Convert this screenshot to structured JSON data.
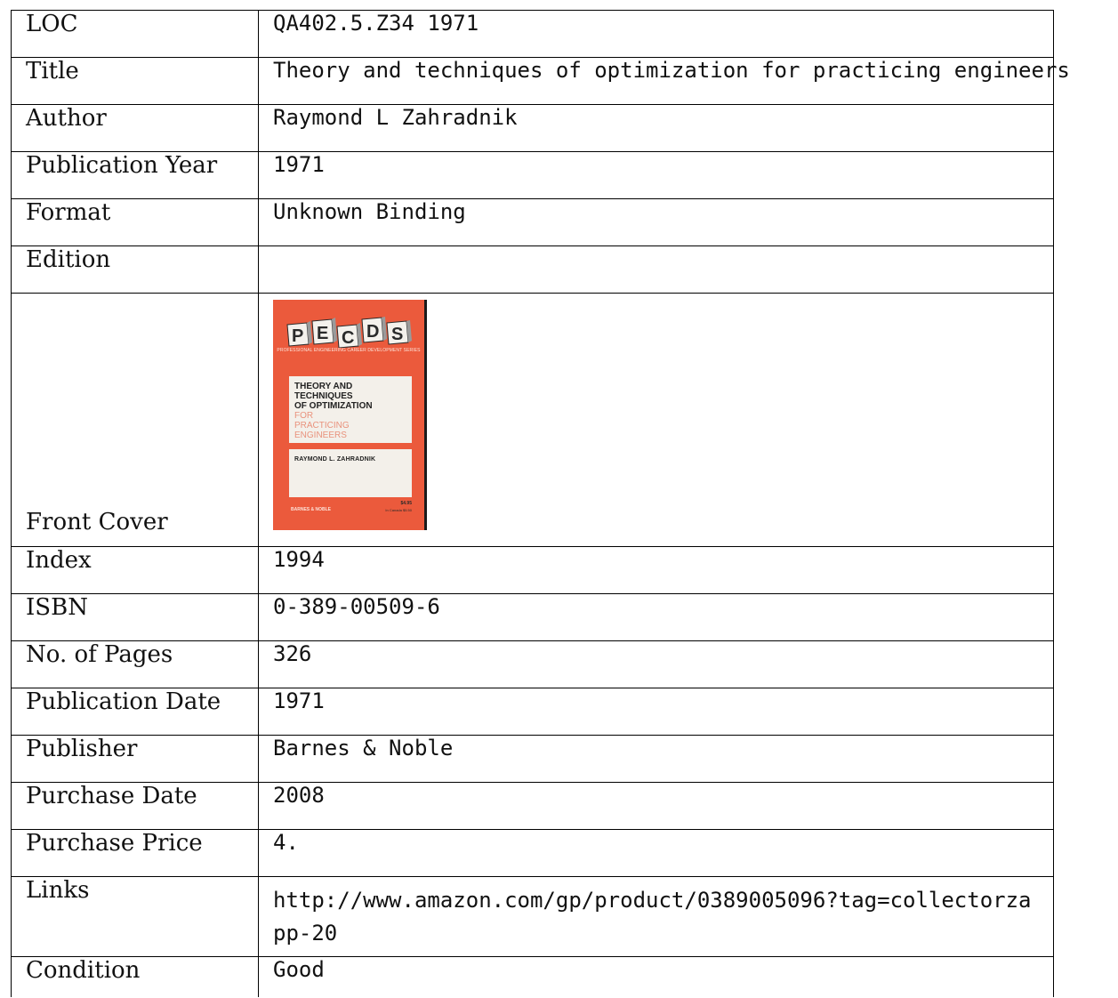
{
  "record": {
    "loc": {
      "label": "LOC",
      "value": "QA402.5.Z34 1971"
    },
    "title": {
      "label": "Title",
      "value": "Theory and techniques of optimization for practicing engineers"
    },
    "author": {
      "label": "Author",
      "value": "Raymond L Zahradnik"
    },
    "publication_year": {
      "label": "Publication Year",
      "value": "1971"
    },
    "format": {
      "label": "Format",
      "value": "Unknown Binding"
    },
    "edition": {
      "label": "Edition",
      "value": ""
    },
    "front_cover": {
      "label": "Front Cover"
    },
    "index": {
      "label": "Index",
      "value": "1994"
    },
    "isbn": {
      "label": "ISBN",
      "value": "0-389-00509-6"
    },
    "pages": {
      "label": "No. of Pages",
      "value": "326"
    },
    "publication_date": {
      "label": "Publication Date",
      "value": "1971"
    },
    "publisher": {
      "label": "Publisher",
      "value": "Barnes & Noble"
    },
    "purchase_date": {
      "label": "Purchase Date",
      "value": "2008"
    },
    "purchase_price": {
      "label": "Purchase Price",
      "value": "4."
    },
    "links": {
      "label": "Links",
      "value": "http://www.amazon.com/gp/product/0389005096?tag=collectorzapp-20"
    },
    "condition": {
      "label": "Condition",
      "value": "Good"
    }
  },
  "cover": {
    "logo_text": "PECDS",
    "series": "PROFESSIONAL ENGINEERING CAREER DEVELOPMENT SERIES",
    "title_dark": [
      "THEORY AND",
      "TECHNIQUES",
      "OF OPTIMIZATION"
    ],
    "title_light": [
      "FOR",
      "PRACTICING",
      "ENGINEERS"
    ],
    "author": "RAYMOND L. ZAHRADNIK",
    "publisher": "BARNES & NOBLE",
    "price": "$4.95",
    "price_canada": "In Canada $5.50",
    "colors": {
      "background": "#eb5a3c",
      "panel": "#f3f0ea",
      "accent_text": "#e9927c"
    }
  }
}
